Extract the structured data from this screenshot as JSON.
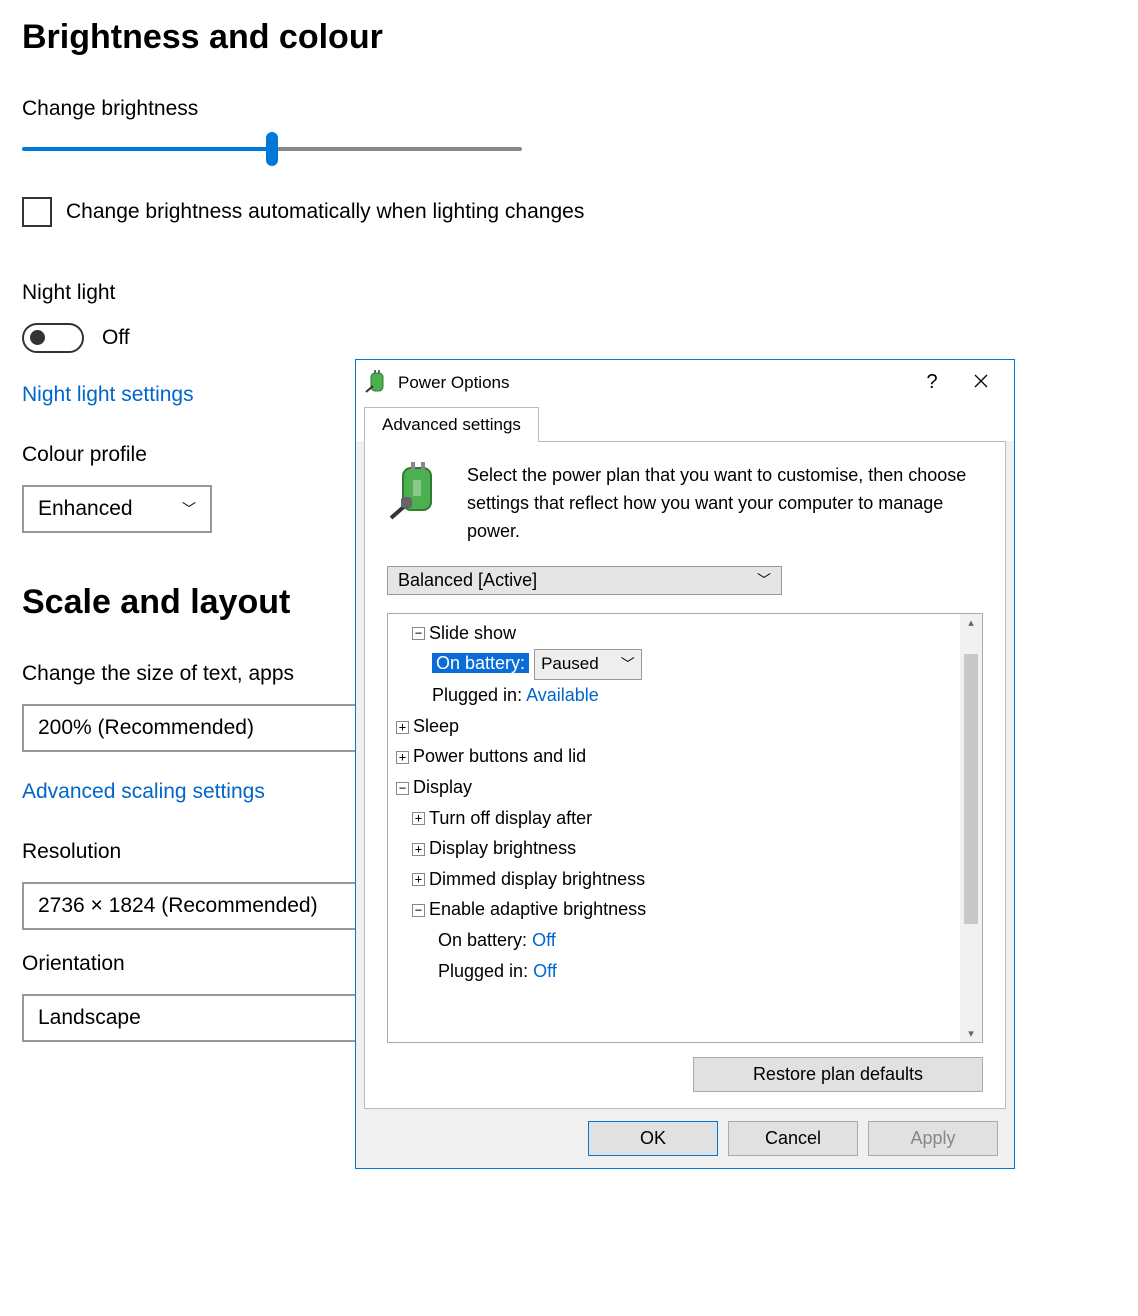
{
  "settings": {
    "heading_brightness": "Brightness and colour",
    "change_brightness_label": "Change brightness",
    "brightness_value_percent": 50,
    "auto_brightness_label": "Change brightness automatically when lighting changes",
    "auto_brightness_checked": false,
    "night_light_label": "Night light",
    "night_light_state": "Off",
    "night_light_settings_link": "Night light settings",
    "colour_profile_label": "Colour profile",
    "colour_profile_value": "Enhanced",
    "heading_scale": "Scale and layout",
    "scale_label": "Change the size of text, apps",
    "scale_value": "200% (Recommended)",
    "advanced_scaling_link": "Advanced scaling settings",
    "resolution_label": "Resolution",
    "resolution_value": "2736 × 1824 (Recommended)",
    "orientation_label": "Orientation",
    "orientation_value": "Landscape"
  },
  "dialog": {
    "title": "Power Options",
    "tab_label": "Advanced settings",
    "description": "Select the power plan that you want to customise, then choose settings that reflect how you want your computer to manage power.",
    "plan_value": "Balanced [Active]",
    "tree": {
      "slide_show": "Slide show",
      "on_battery_label": "On battery:",
      "on_battery_value": "Paused",
      "plugged_in_label": "Plugged in:",
      "plugged_in_value": "Available",
      "sleep": "Sleep",
      "power_buttons": "Power buttons and lid",
      "display": "Display",
      "turn_off_display": "Turn off display after",
      "display_brightness": "Display brightness",
      "dimmed_brightness": "Dimmed display brightness",
      "adaptive_brightness": "Enable adaptive brightness",
      "adaptive_on_battery_label": "On battery:",
      "adaptive_on_battery_value": "Off",
      "adaptive_plugged_in_label": "Plugged in:",
      "adaptive_plugged_in_value": "Off"
    },
    "restore_button": "Restore plan defaults",
    "ok_button": "OK",
    "cancel_button": "Cancel",
    "apply_button": "Apply"
  }
}
